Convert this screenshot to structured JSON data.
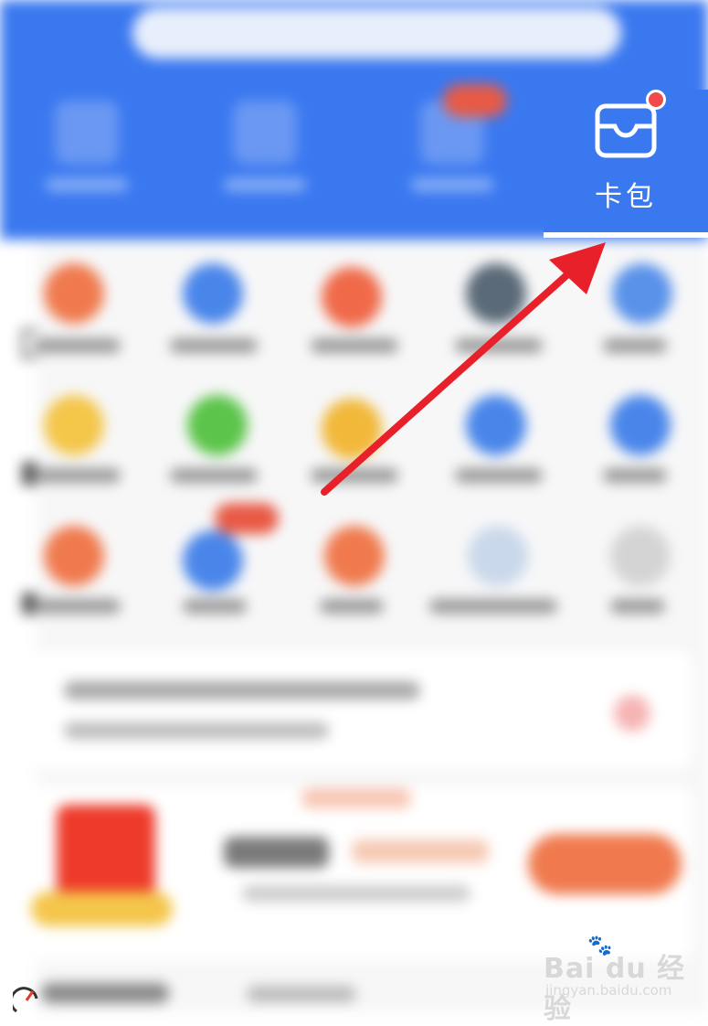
{
  "highlight": {
    "icon": "card-wallet-icon",
    "label": "卡包"
  },
  "watermark": {
    "logo_text": "Bai du 经验",
    "url": "jingyan.baidu.com"
  },
  "colors": {
    "header_blue": "#3a78f0",
    "arrow_red": "#e8202a",
    "badge_red": "#f04a4a"
  }
}
